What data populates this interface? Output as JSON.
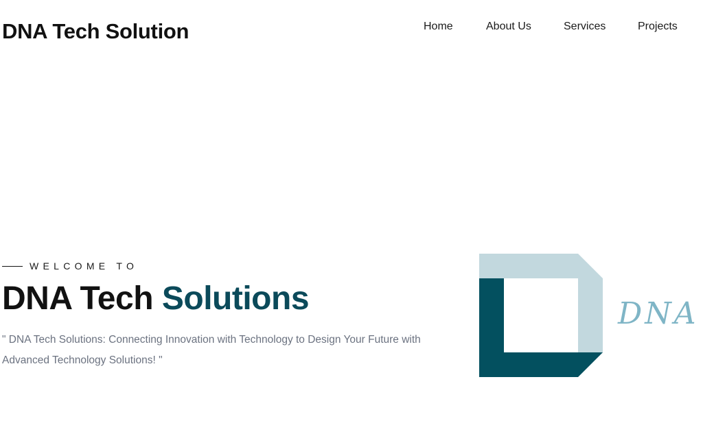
{
  "header": {
    "brand": "DNA Tech Solution",
    "nav": {
      "home": "Home",
      "about": "About Us",
      "services": "Services",
      "projects": "Projects"
    }
  },
  "hero": {
    "welcome": "WELCOME TO",
    "title_part1": "DNA Tech ",
    "title_part2": "Solutions",
    "description": "\" DNA Tech Solutions: Connecting Innovation with Technology to Design Your Future with Advanced Technology Solutions! \""
  },
  "logo": {
    "text": "DNA T",
    "colors": {
      "light": "#c2d8de",
      "dark": "#03505f",
      "text": "#7fb5c6"
    }
  },
  "colors": {
    "accent": "#0b4a5a",
    "body_text": "#6b7280"
  }
}
